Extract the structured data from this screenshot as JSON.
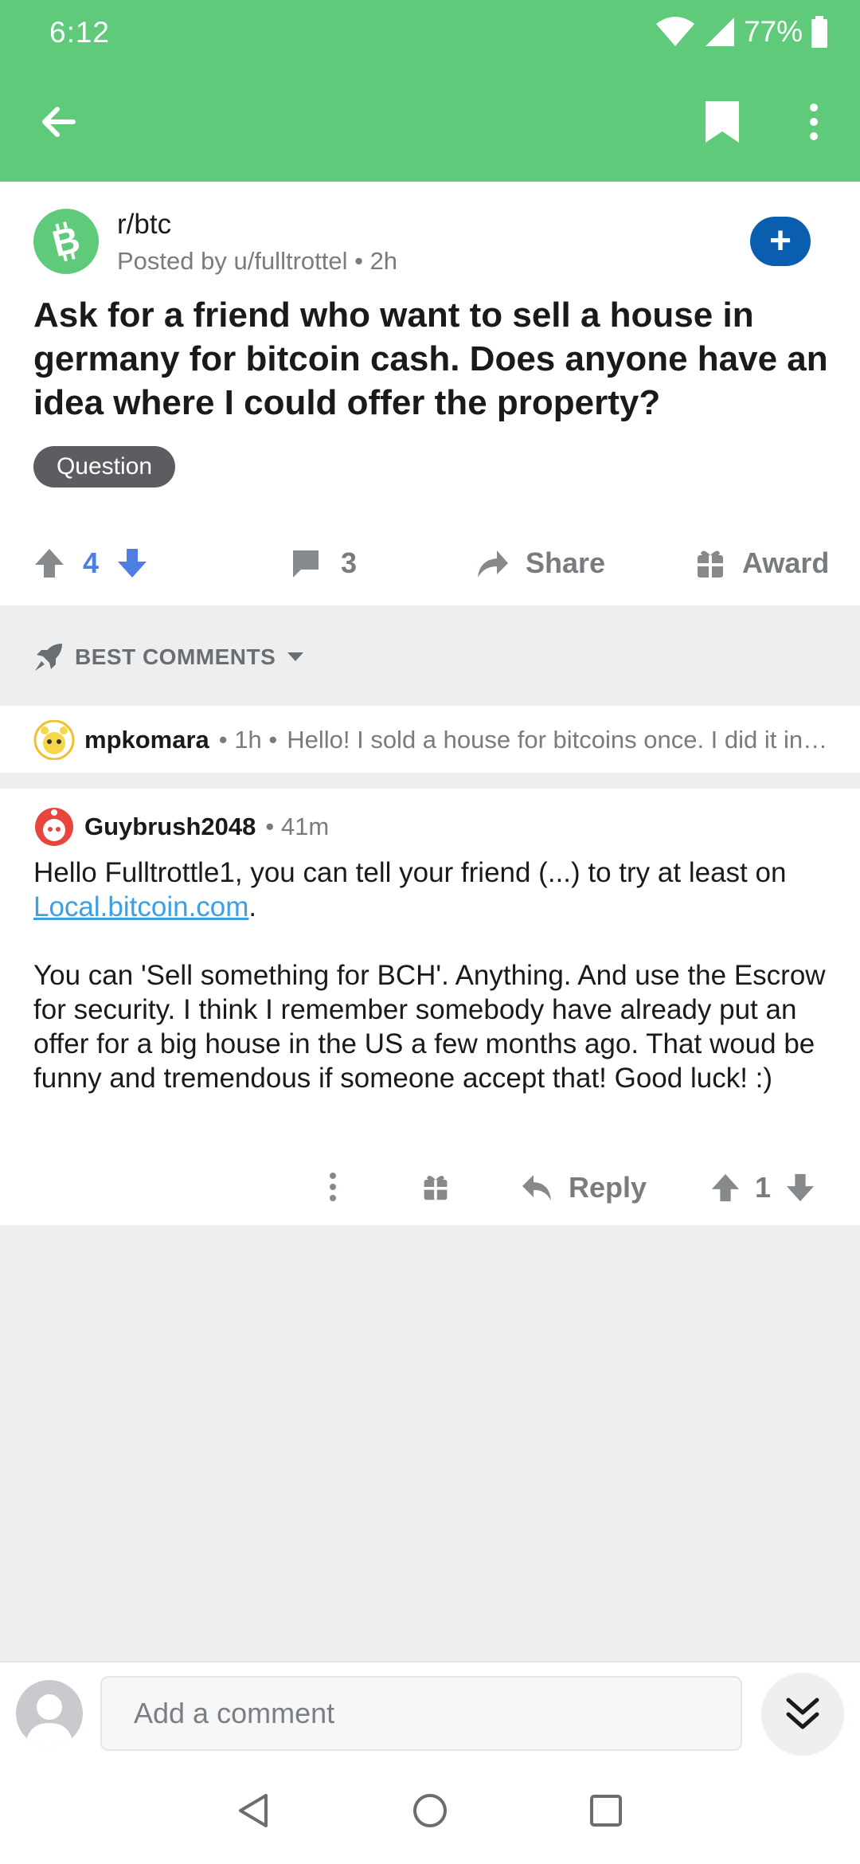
{
  "status_bar": {
    "time": "6:12",
    "battery_pct": "77%"
  },
  "colors": {
    "header": "#5fcb7a",
    "accent_blue": "#4f7ee3",
    "join_button": "#0a5eb0",
    "link": "#3b9fe0"
  },
  "toolbar": {
    "back_icon": "arrow-left-icon",
    "save_icon": "bookmark-icon",
    "more_icon": "more-vertical-icon"
  },
  "post": {
    "subreddit": "r/btc",
    "meta": "Posted by u/fulltrottel • 2h",
    "title": "Ask for a friend who want to sell a house in germany for bitcoin cash. Does anyone have an idea where I could offer the property?",
    "flair": "Question",
    "votes": "4",
    "comments": "3",
    "share_label": "Share",
    "award_label": "Award"
  },
  "sort": {
    "label": "BEST COMMENTS"
  },
  "comments": [
    {
      "author": "mpkomara",
      "age": "• 1h •",
      "snippet": "Hello! I sold a house for bitcoins once. I did it in a very long and weird way through several exchanges"
    },
    {
      "author": "Guybrush2048",
      "age": "• 41m",
      "body_pre": "Hello Fulltrottle1, you can tell your friend (...) to try at least on ",
      "link": "Local.bitcoin.com",
      "body_post": ".",
      "body_2": "You can 'Sell something for BCH'. Anything. And use the Escrow for security. I think I remember somebody have already put an offer for a big house in the US a few months ago. That woud be funny and tremendous if someone accept that! Good luck! :)",
      "reply_label": "Reply",
      "votes": "1"
    }
  ],
  "composer": {
    "placeholder": "Add a comment"
  }
}
